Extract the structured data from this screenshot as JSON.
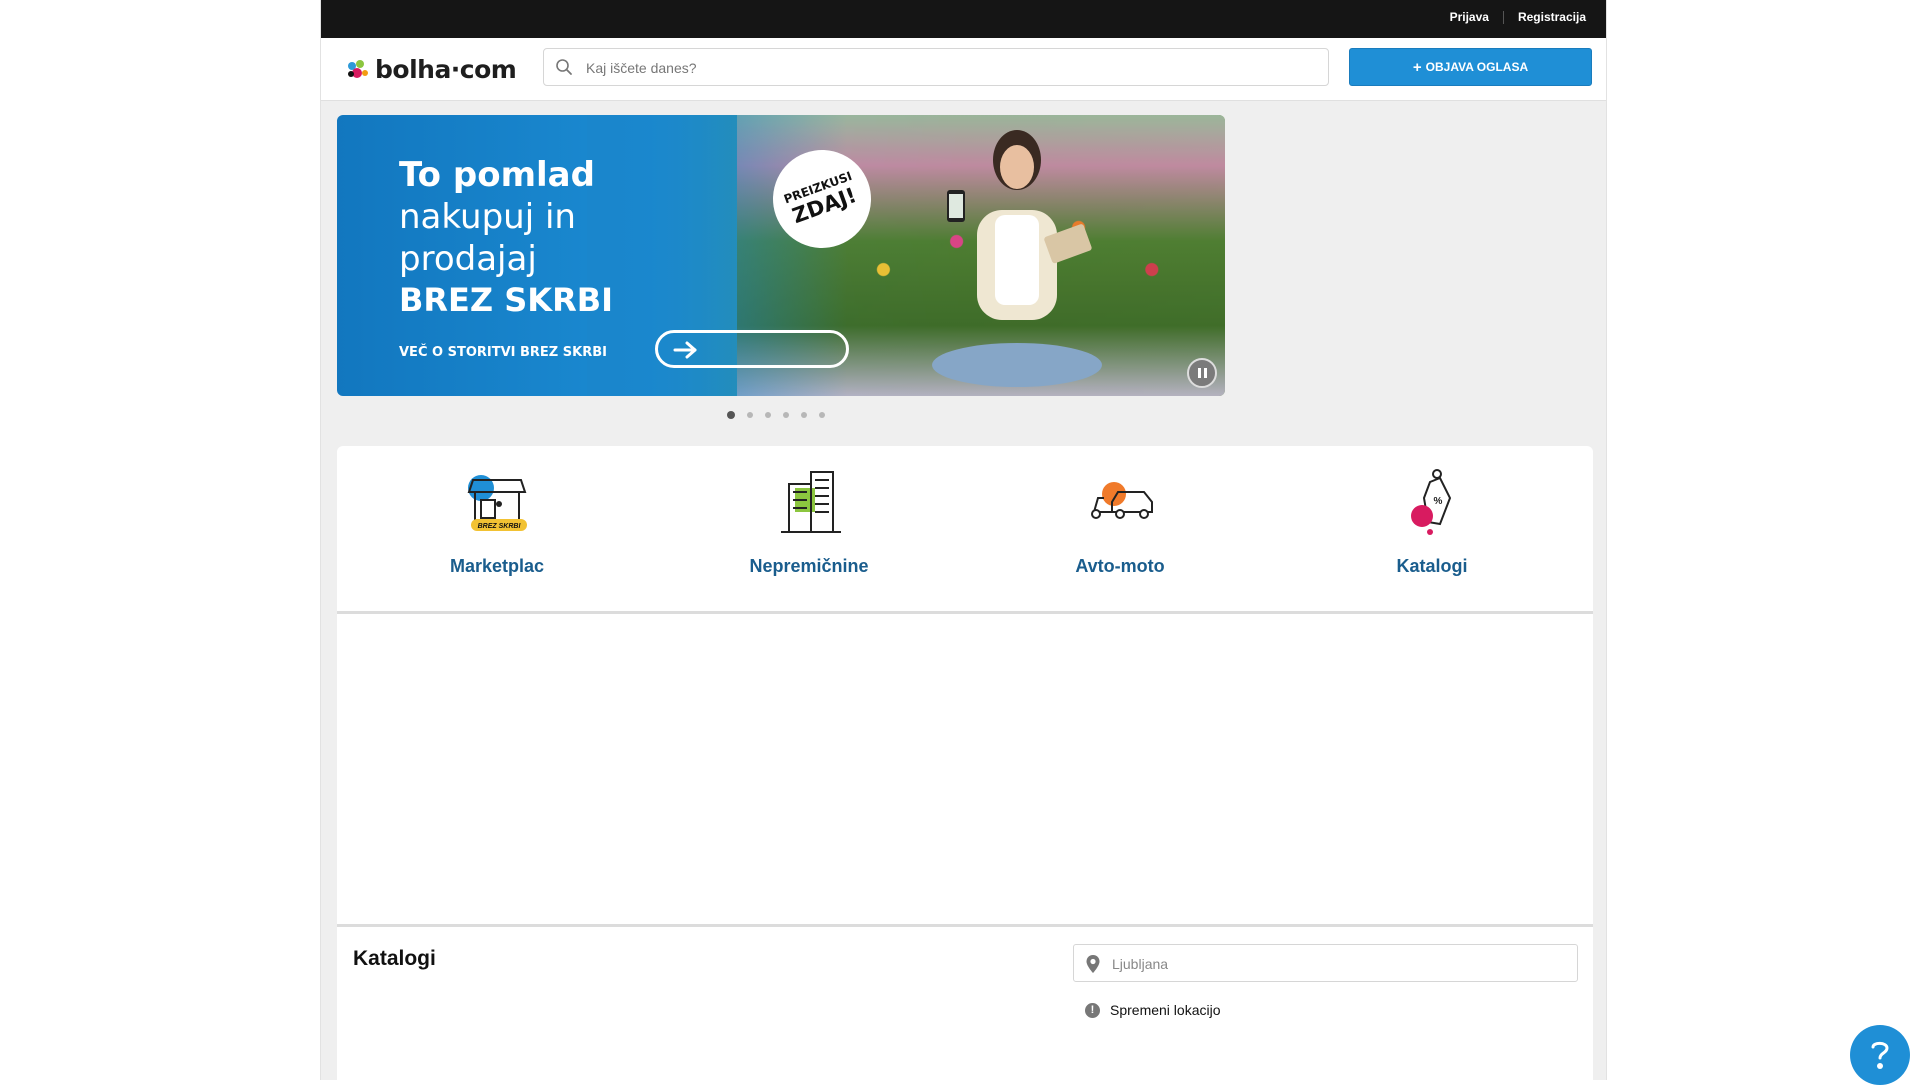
{
  "topbar": {
    "login": "Prijava",
    "register": "Registracija"
  },
  "header": {
    "logo_text": "bolha·com",
    "search_placeholder": "Kaj iščete danes?",
    "post_button": "OBJAVA OGLASA",
    "post_button_icon": "+"
  },
  "banner": {
    "line1": "To pomlad",
    "line2": "nakupuj in",
    "line3": "prodajaj",
    "line4": "BREZ SKRBI",
    "cta": "VEČ O STORITVI BREZ SKRBI",
    "badge_top": "PREIZKUSI",
    "badge_main": "ZDAJ!",
    "slides": 6,
    "active_slide": 1
  },
  "categories": [
    {
      "label": "Marketplac",
      "icon": "market-stall-icon",
      "tag": "BREZ SKRBI"
    },
    {
      "label": "Nepremičnine",
      "icon": "buildings-icon"
    },
    {
      "label": "Avto-moto",
      "icon": "car-scooter-icon"
    },
    {
      "label": "Katalogi",
      "icon": "price-tag-icon"
    }
  ],
  "katalogi": {
    "title": "Katalogi",
    "location_placeholder": "Ljubljana",
    "change_location": "Spremeni lokacijo"
  },
  "colors": {
    "accent": "#1f8fd6",
    "topbar": "#151515",
    "category_label": "#1a5d8d"
  }
}
